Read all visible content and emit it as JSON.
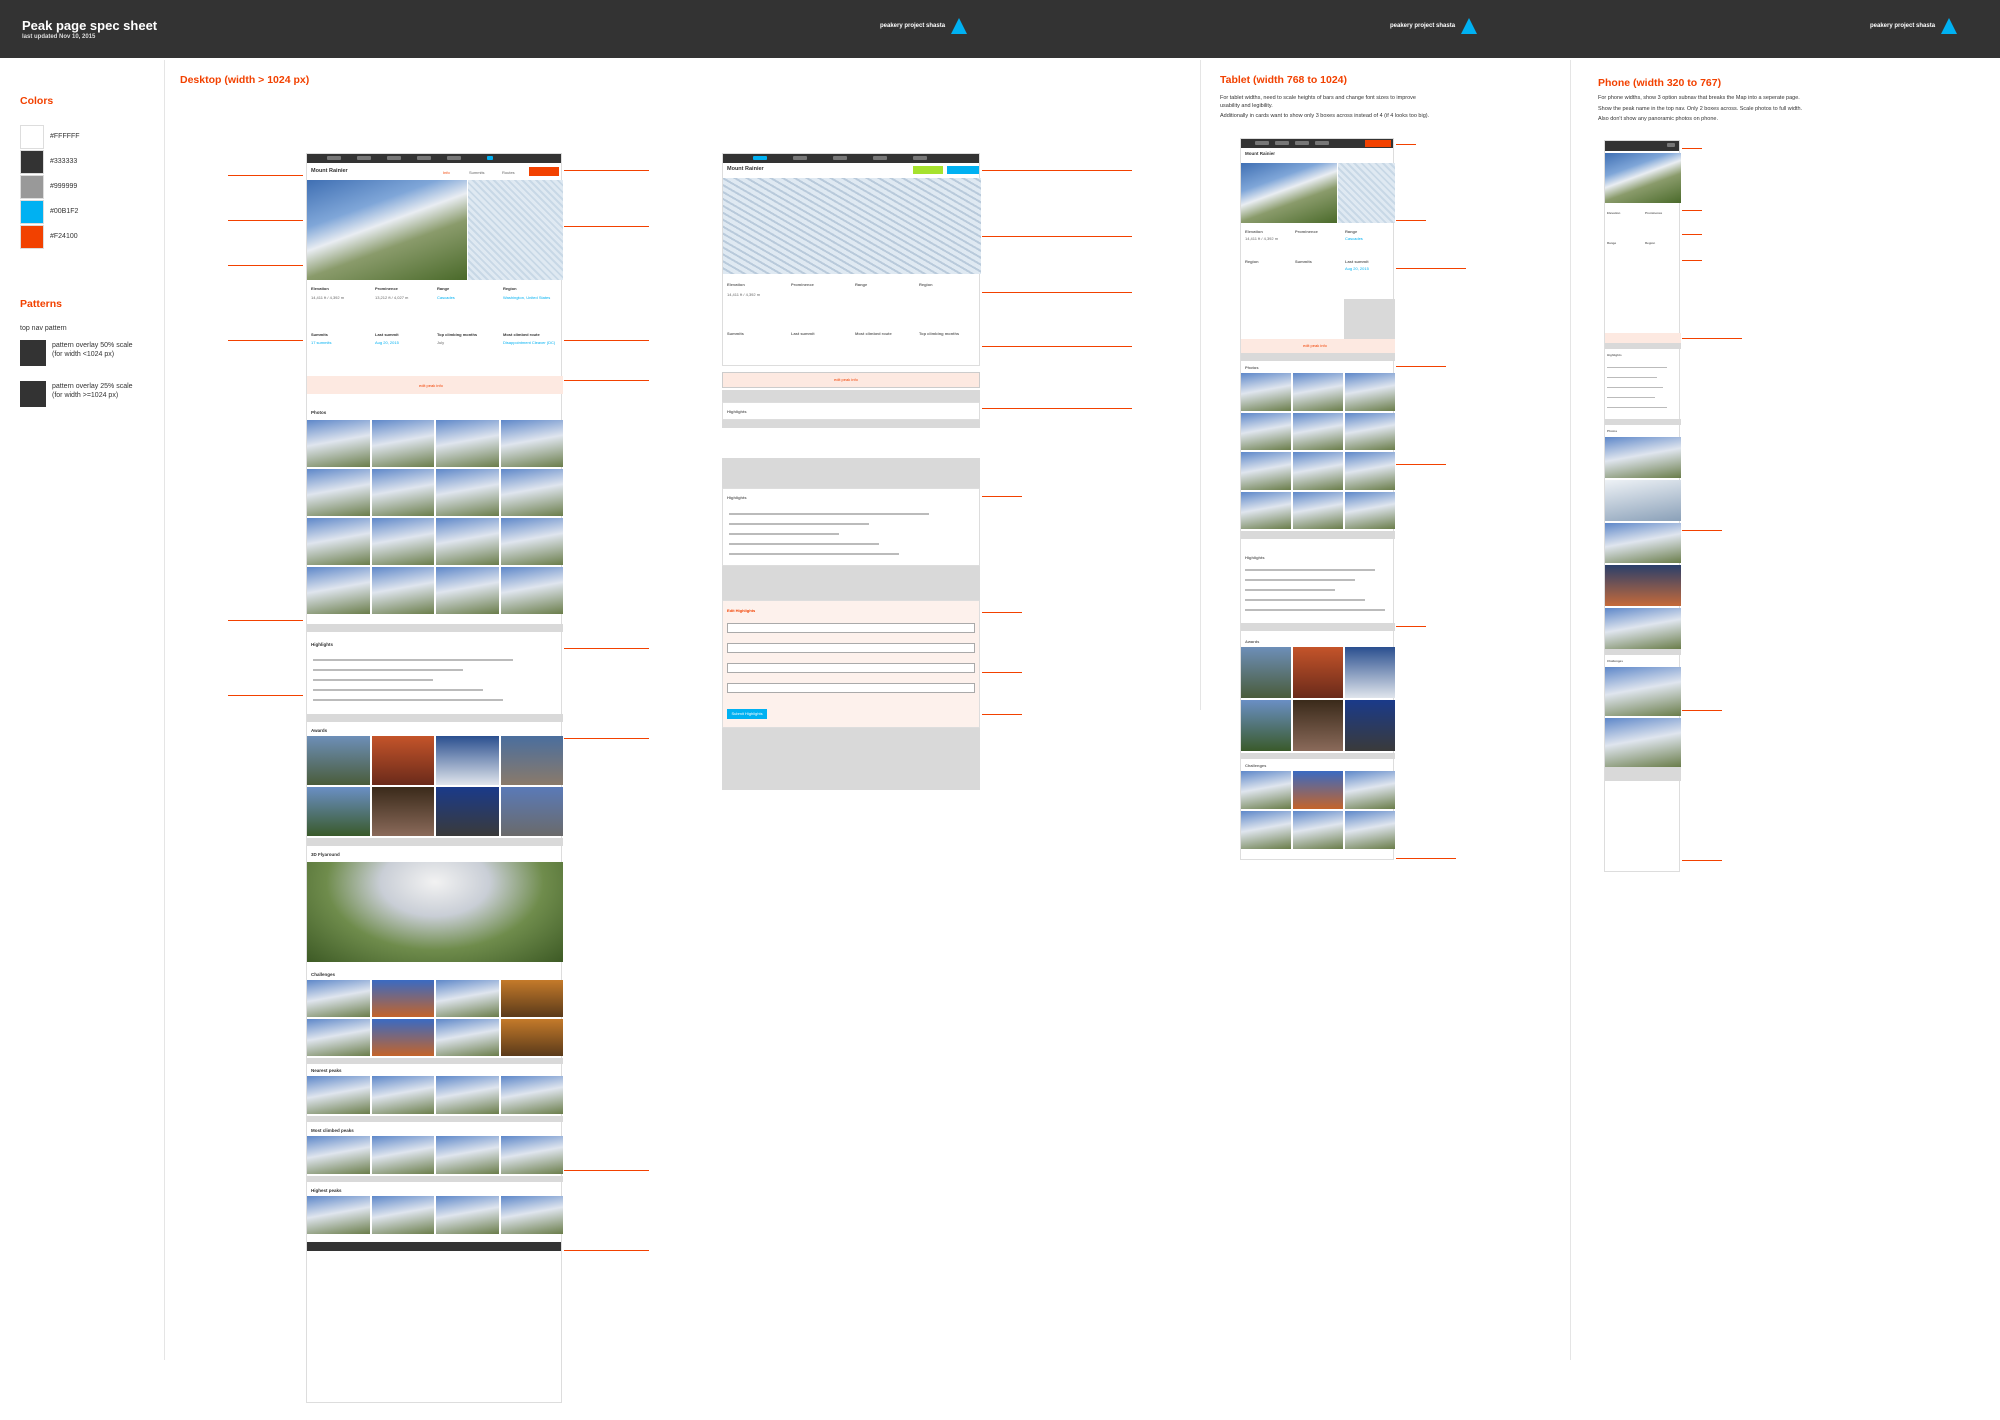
{
  "header": {
    "title": "Peak page spec sheet",
    "subtitle": "last updated Nov 10, 2015",
    "brand": "peakery project shasta",
    "accent": "#00B1F2",
    "bg": "#333333"
  },
  "sidebar": {
    "colors_heading": "Colors",
    "colors": [
      {
        "label": "#FFFFFF",
        "hex": "#FFFFFF"
      },
      {
        "label": "#333333",
        "hex": "#333333"
      },
      {
        "label": "#999999",
        "hex": "#999999"
      },
      {
        "label": "#00B1F2",
        "hex": "#00B1F2"
      },
      {
        "label": "#F24100",
        "hex": "#F24100"
      }
    ],
    "patterns_heading": "Patterns",
    "pattern_title": "top nav pattern",
    "patterns": [
      {
        "line1": "pattern overlay 50% scale",
        "line2": "(for width <1024 px)"
      },
      {
        "line1": "pattern overlay 25% scale",
        "line2": "(for width >=1024 px)"
      }
    ]
  },
  "sections": {
    "desktop": "Desktop (width > 1024 px)",
    "tablet": "Tablet (width 768 to 1024)",
    "phone": "Phone (width 320 to 767)"
  },
  "tablet_notes": {
    "line1": "For tablet widths, need to scale heights of bars and change font sizes to improve",
    "line2": "usability and legibility.",
    "line3": "Additionally in cards want to show only 3 boxes across instead of 4 (if 4 looks too big)."
  },
  "phone_notes": {
    "line1": "For phone widths, show 3 option subnav that breaks the Map into a seperate page.",
    "line2": "Show the peak name in the top nav. Only 2 boxes across. Scale photos to full width.",
    "line3": "Also don't show any panoramic photos on phone."
  },
  "mock": {
    "peak_name": "Mount Rainier",
    "stats_labels": [
      "Elevation",
      "Prominence",
      "Range",
      "Region"
    ],
    "stats_values": [
      "14,411 ft / 4,392 m",
      "13,212 ft / 4,027 m",
      "Cascades",
      "Washington, United States"
    ],
    "summit_labels": [
      "Summits",
      "Last summit",
      "Top climbing months",
      "Most climbed route"
    ],
    "summit_values": [
      "17 summits",
      "Aug 20, 2015",
      "July",
      "Disappointment Cleaver (DC)"
    ],
    "edit_peak_info": "edit peak info",
    "photos": "Photos",
    "highlights": "Highlights",
    "awards": "Awards",
    "flyaround": "3D Flyaround",
    "challenges": "Challenges",
    "nearest": "Nearest peaks",
    "most_climbed": "Most climbed peaks",
    "highest": "Highest peaks",
    "submit_highlights": "Submit Highlights",
    "edit_highlights": "Edit Highlights"
  }
}
